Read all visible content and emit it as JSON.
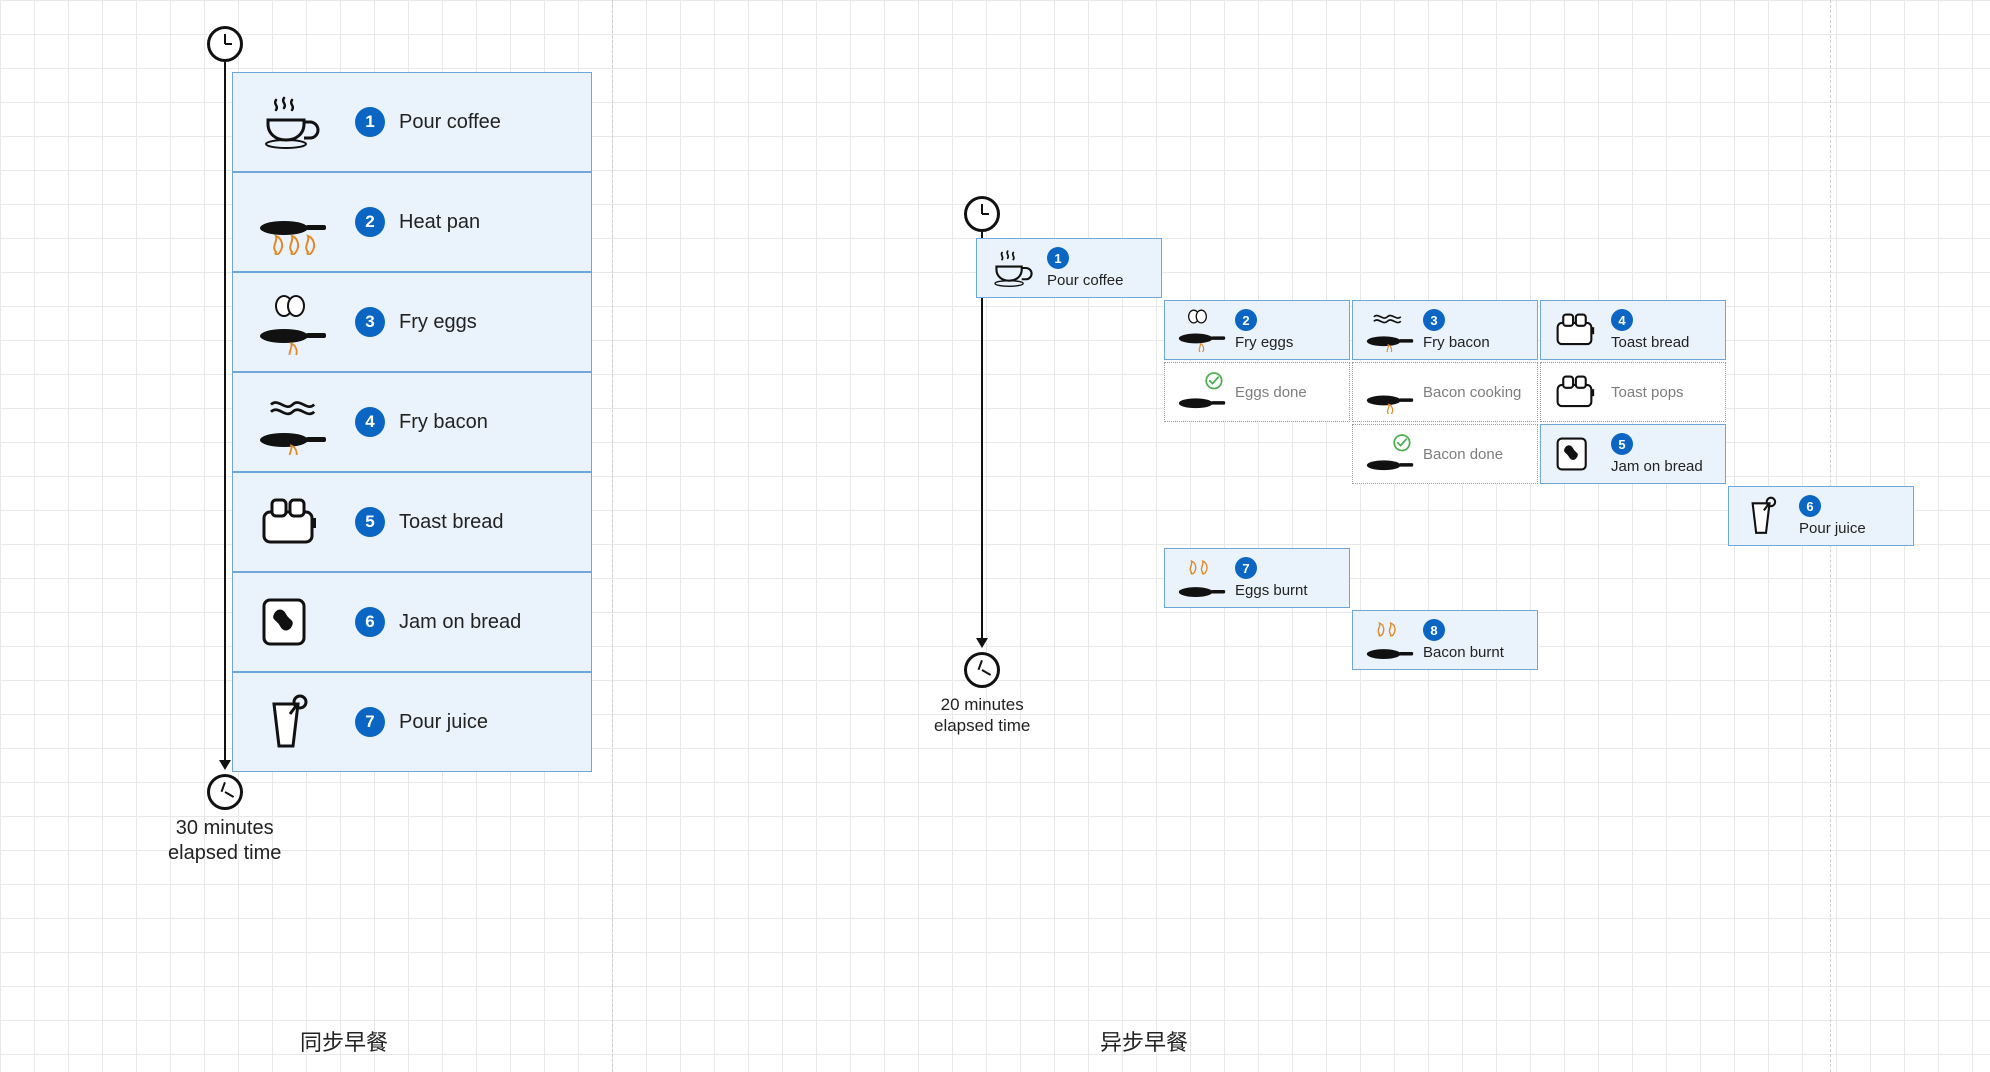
{
  "sync": {
    "caption": "同步早餐",
    "elapsed_line1": "30 minutes",
    "elapsed_line2": "elapsed time",
    "steps": [
      {
        "n": "1",
        "label": "Pour coffee",
        "icon": "coffee"
      },
      {
        "n": "2",
        "label": "Heat pan",
        "icon": "pan-flames"
      },
      {
        "n": "3",
        "label": "Fry eggs",
        "icon": "pan-eggs"
      },
      {
        "n": "4",
        "label": "Fry bacon",
        "icon": "pan-bacon"
      },
      {
        "n": "5",
        "label": "Toast bread",
        "icon": "toaster"
      },
      {
        "n": "6",
        "label": "Jam on bread",
        "icon": "jam-bread"
      },
      {
        "n": "7",
        "label": "Pour juice",
        "icon": "juice"
      }
    ]
  },
  "async": {
    "caption": "异步早餐",
    "elapsed_line1": "20 minutes",
    "elapsed_line2": "elapsed time",
    "cards": [
      {
        "n": "1",
        "label": "Pour coffee",
        "icon": "coffee",
        "col": 0,
        "row": 0,
        "ghost": false
      },
      {
        "n": "2",
        "label": "Fry eggs",
        "icon": "pan-eggs-flame",
        "col": 1,
        "row": 1,
        "ghost": false
      },
      {
        "n": "3",
        "label": "Fry bacon",
        "icon": "pan-bacon-flame",
        "col": 2,
        "row": 1,
        "ghost": false
      },
      {
        "n": "4",
        "label": "Toast bread",
        "icon": "toaster",
        "col": 3,
        "row": 1,
        "ghost": false
      },
      {
        "n": "",
        "label": "Eggs done",
        "icon": "pan-check",
        "col": 1,
        "row": 2,
        "ghost": true
      },
      {
        "n": "",
        "label": "Bacon cooking",
        "icon": "pan-flame",
        "col": 2,
        "row": 2,
        "ghost": true
      },
      {
        "n": "",
        "label": "Toast pops",
        "icon": "toaster",
        "col": 3,
        "row": 2,
        "ghost": true
      },
      {
        "n": "",
        "label": "Bacon done",
        "icon": "pan-check",
        "col": 2,
        "row": 3,
        "ghost": true
      },
      {
        "n": "5",
        "label": "Jam on bread",
        "icon": "jam-bread",
        "col": 3,
        "row": 3,
        "ghost": false
      },
      {
        "n": "6",
        "label": "Pour juice",
        "icon": "juice",
        "col": 4,
        "row": 4,
        "ghost": false
      },
      {
        "n": "7",
        "label": "Eggs burnt",
        "icon": "pan-burnt",
        "col": 1,
        "row": 5,
        "ghost": false
      },
      {
        "n": "8",
        "label": "Bacon burnt",
        "icon": "pan-burnt",
        "col": 2,
        "row": 6,
        "ghost": false
      }
    ]
  }
}
